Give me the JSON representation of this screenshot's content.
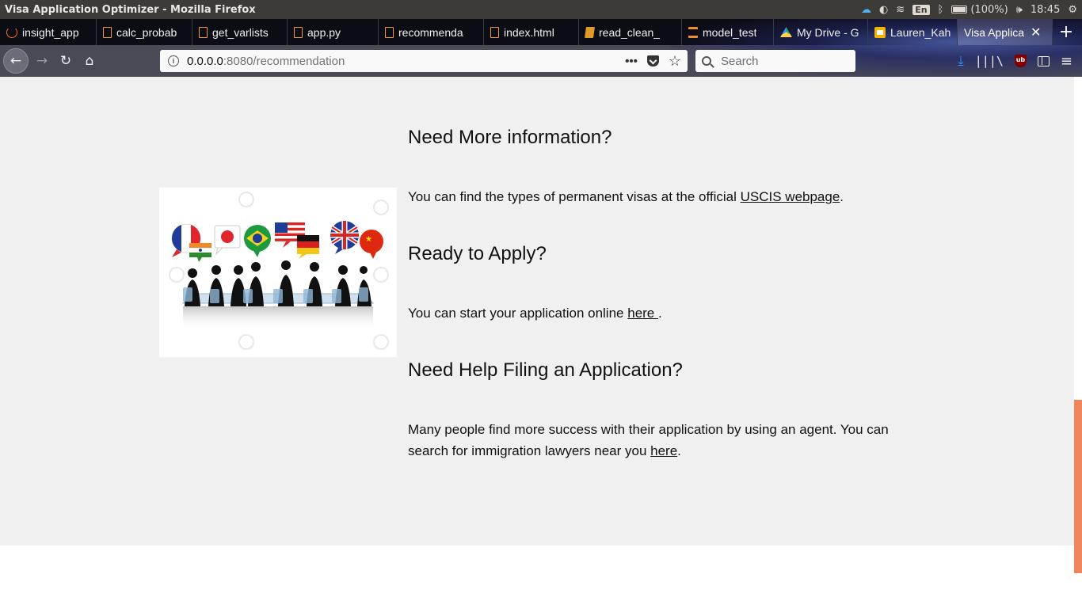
{
  "window": {
    "title": "Visa Application Optimizer - Mozilla Firefox"
  },
  "system_tray": {
    "language": "En",
    "battery": "(100%)",
    "time": "18:45"
  },
  "tabs": [
    {
      "label": "insight_app",
      "icon": "ring-icon"
    },
    {
      "label": "calc_probab",
      "icon": "file-icon"
    },
    {
      "label": "get_varlists",
      "icon": "file-icon"
    },
    {
      "label": "app.py",
      "icon": "file-icon"
    },
    {
      "label": "recommenda",
      "icon": "file-icon"
    },
    {
      "label": "index.html",
      "icon": "file-icon"
    },
    {
      "label": "read_clean_",
      "icon": "book-icon"
    },
    {
      "label": "model_test",
      "icon": "hourglass-icon"
    },
    {
      "label": "My Drive - G",
      "icon": "drive-icon"
    },
    {
      "label": "Lauren_Kah",
      "icon": "slides-icon"
    },
    {
      "label": "Visa Applica",
      "icon": "none",
      "active": true
    }
  ],
  "navbar": {
    "url_host": "0.0.0.0",
    "url_path": ":8080/recommendation",
    "search_placeholder": "Search"
  },
  "page": {
    "sections": [
      {
        "heading": "Need More information?",
        "text_before": "You can find the types of permanent visas at the official ",
        "link": "USCIS webpage",
        "text_after": "."
      },
      {
        "heading": "Ready to Apply?",
        "text_before": "You can start your application online ",
        "link": "here ",
        "text_after": "."
      },
      {
        "heading": "Need Help Filing an Application?",
        "text_before": "Many people find more success with their application by using an agent. You can search for immigration lawyers near you ",
        "link": "here",
        "text_after": "."
      }
    ],
    "illustration": {
      "flags": [
        "france",
        "india",
        "japan",
        "brazil",
        "usa",
        "germany",
        "uk",
        "china"
      ],
      "people_count": 9
    }
  },
  "colors": {
    "content_bg": "#f0f0f0",
    "scroll_thumb": "#f0845a",
    "tab_strip_bg": "#0c0c15",
    "nav_bar_bg": "#4a4a56"
  }
}
